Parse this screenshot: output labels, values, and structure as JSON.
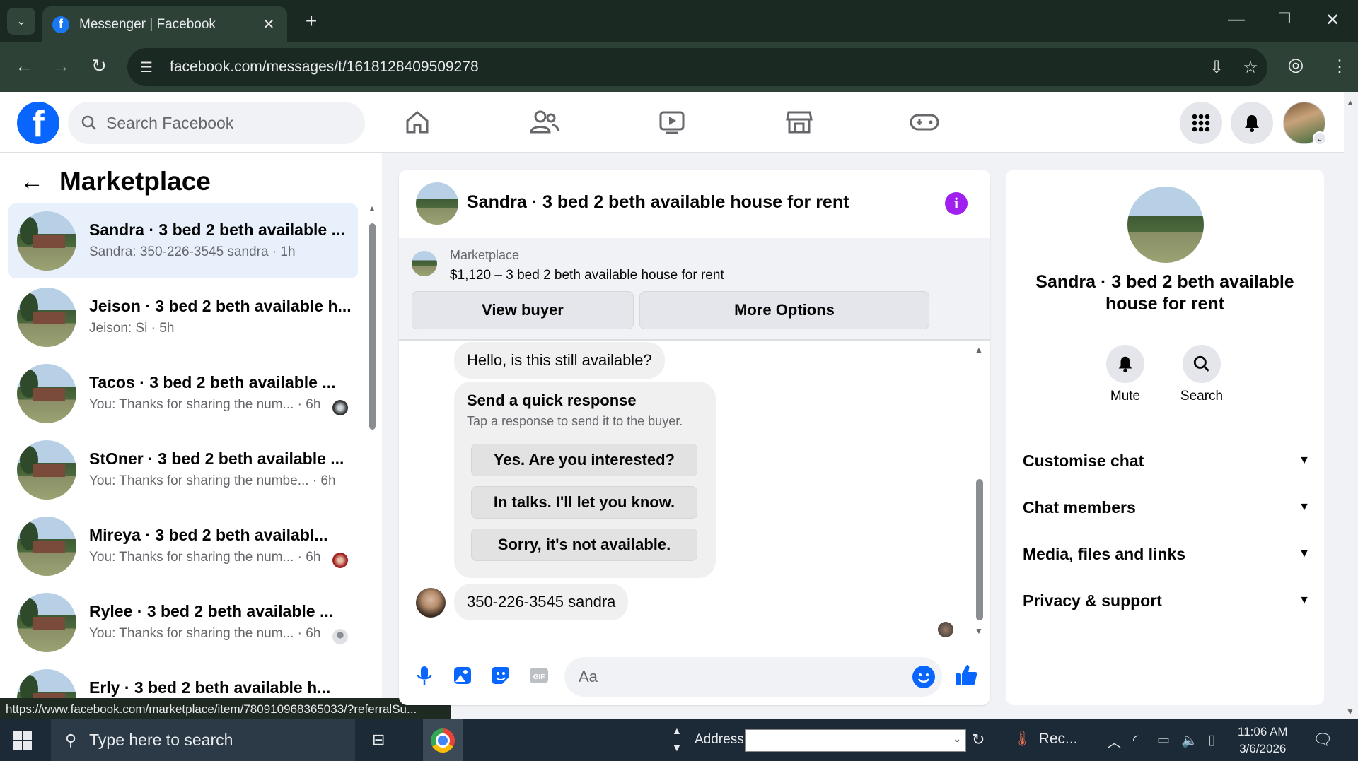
{
  "browser": {
    "tab_title": "Messenger | Facebook",
    "url": "facebook.com/messages/t/1618128409509278",
    "status_url": "https://www.facebook.com/marketplace/item/780910968365033/?referralSu..."
  },
  "fb_nav": {
    "search_placeholder": "Search Facebook"
  },
  "left": {
    "title": "Marketplace",
    "conversations": [
      {
        "name": "Sandra · 3 bed 2 beth available ...",
        "snippet": "Sandra: 350-226-3545 sandra · 1h",
        "active": true
      },
      {
        "name": "Jeison · 3 bed 2 beth available h...",
        "snippet": "Jeison: Si · 5h"
      },
      {
        "name": "Tacos · 3 bed 2 beth available ...",
        "snippet": "You: Thanks for sharing the num... · 6h"
      },
      {
        "name": "StOner · 3 bed 2 beth available ...",
        "snippet": "You: Thanks for sharing the numbe... · 6h"
      },
      {
        "name": "Mireya · 3 bed 2 beth availabl...",
        "snippet": "You: Thanks for sharing the num... · 6h"
      },
      {
        "name": "Rylee · 3 bed 2 beth available ...",
        "snippet": "You: Thanks for sharing the num... · 6h"
      },
      {
        "name": "Erly · 3 bed 2 beth available h...",
        "snippet": ""
      }
    ]
  },
  "chat": {
    "title": "Sandra · 3 bed 2 beth available house for rent",
    "marketplace_label": "Marketplace",
    "listing": "$1,120 – 3 bed 2 beth available house for rent",
    "view_buyer": "View buyer",
    "more_options": "More Options",
    "msg1": "Hello, is this still available?",
    "quick_title": "Send a quick response",
    "quick_sub": "Tap a response to send it to the buyer.",
    "quick_replies": [
      "Yes. Are you interested?",
      "In talks. I'll let you know.",
      "Sorry, it's not available."
    ],
    "msg2": "350-226-3545 sandra",
    "input_placeholder": "Aa"
  },
  "right": {
    "title": "Sandra · 3 bed 2 beth available house for rent",
    "mute": "Mute",
    "search": "Search",
    "sections": [
      "Customise chat",
      "Chat members",
      "Media, files and links",
      "Privacy & support"
    ]
  },
  "taskbar": {
    "search_placeholder": "Type here to search",
    "address_label": "Address",
    "app_label": "Rec...",
    "time": "11:06 AM",
    "date": "3/6/2026"
  }
}
